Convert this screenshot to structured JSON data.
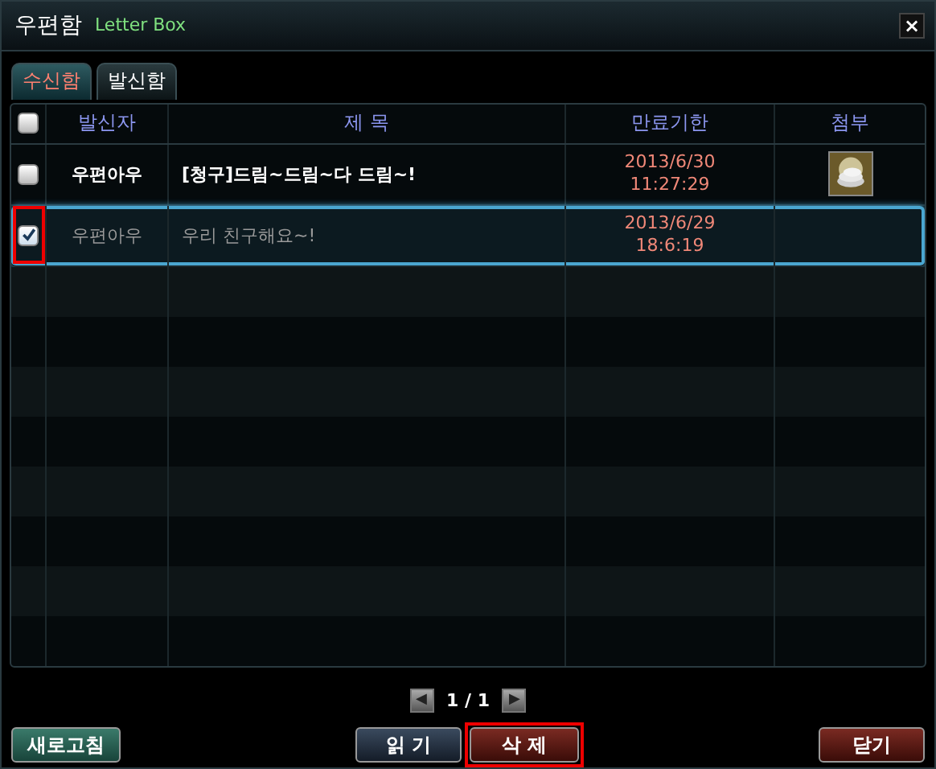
{
  "window": {
    "title": "우편함",
    "subtitle": "Letter Box",
    "close": "×"
  },
  "tabs": [
    {
      "label": "수신함",
      "selected": true
    },
    {
      "label": "발신함",
      "selected": false
    }
  ],
  "table": {
    "select_all": {
      "checked": false
    },
    "columns": [
      "발신자",
      "제 목",
      "만료기한",
      "첨부"
    ],
    "rows": [
      {
        "checked": false,
        "selected": false,
        "read": false,
        "highlighted": false,
        "sender": "우편아우",
        "subject": "[청구]드림~드림~다 드림~!",
        "expiry": [
          "2013/6/30",
          "11:27:29"
        ],
        "attachment": true
      },
      {
        "checked": true,
        "selected": true,
        "read": true,
        "highlighted": true,
        "sender": "우편아우",
        "subject": "우리 친구해요~!",
        "expiry": [
          "2013/6/29",
          "18:6:19"
        ],
        "attachment": false
      }
    ]
  },
  "pagination": {
    "prev": "◀",
    "page": "1 / 1",
    "next": "▶"
  },
  "buttons": [
    {
      "label": "새로고침",
      "kind": "green",
      "highlighted": false
    },
    {
      "label": "읽 기",
      "kind": "blue",
      "highlighted": false
    },
    {
      "label": "삭 제",
      "kind": "red",
      "highlighted": true
    },
    {
      "label": "닫기",
      "kind": "red",
      "highlighted": false
    }
  ]
}
